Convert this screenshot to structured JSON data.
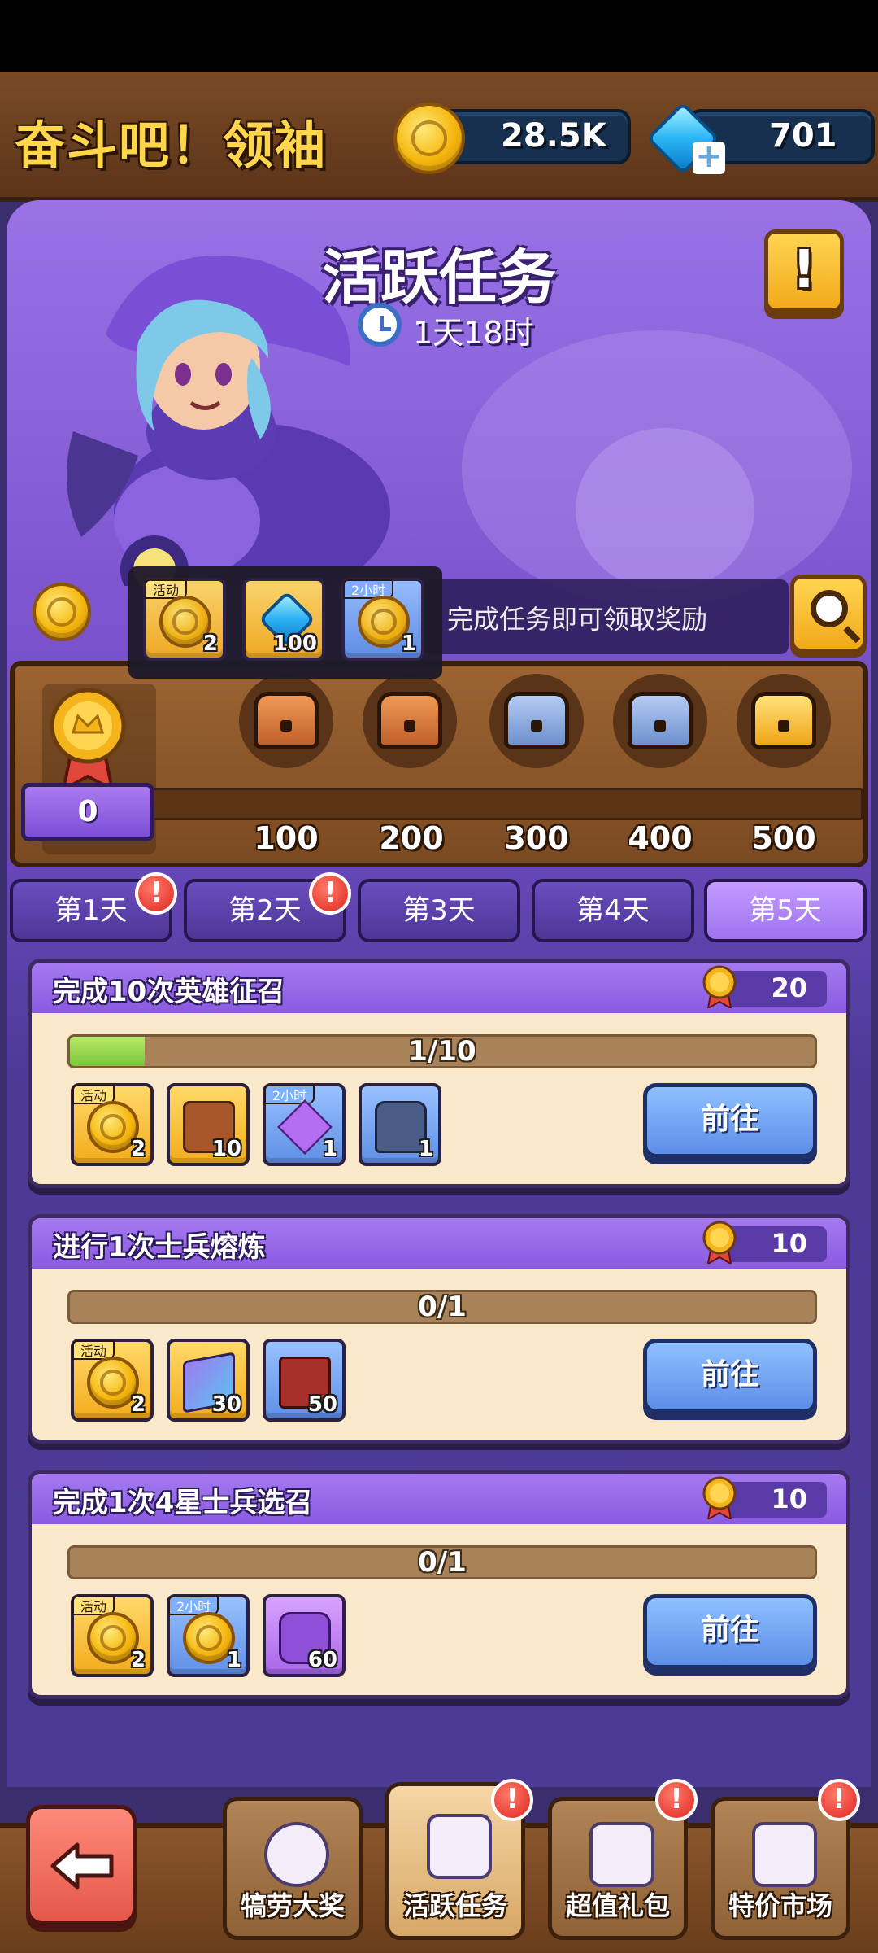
{
  "header": {
    "game_title": "奋斗吧！领袖",
    "coins": "28.5K",
    "gems": "701"
  },
  "event": {
    "title": "活跃任务",
    "time_left": "1天18时",
    "hint": "完成任务即可领取奖励"
  },
  "tooltip_rewards": [
    {
      "icon": "activity-coin-icon",
      "tag": "活动",
      "count": "2",
      "style": "gold"
    },
    {
      "icon": "gem-icon",
      "tag": "",
      "count": "100",
      "style": "gold"
    },
    {
      "icon": "coin-icon",
      "tag": "2小时",
      "count": "1",
      "style": "blue"
    }
  ],
  "milestones": {
    "current_points": "0",
    "progress": 0,
    "thresholds": [
      "100",
      "200",
      "300",
      "400",
      "500"
    ],
    "chests": [
      "bronze",
      "bronze",
      "silver",
      "silver",
      "gold"
    ]
  },
  "days": [
    {
      "label": "第1天",
      "alert": true,
      "active": false
    },
    {
      "label": "第2天",
      "alert": true,
      "active": false
    },
    {
      "label": "第3天",
      "alert": false,
      "active": false
    },
    {
      "label": "第4天",
      "alert": false,
      "active": false
    },
    {
      "label": "第5天",
      "alert": false,
      "active": true
    }
  ],
  "tasks": [
    {
      "title": "完成10次英雄征召",
      "points": "20",
      "progress_text": "1/10",
      "progress": 0.1,
      "button": "前往",
      "rewards": [
        {
          "icon": "activity-coin-icon",
          "tag": "活动",
          "count": "2",
          "style": "gold"
        },
        {
          "icon": "hero-scroll-icon",
          "tag": "",
          "count": "10",
          "style": "gold"
        },
        {
          "icon": "purple-crystal-icon",
          "tag": "2小时",
          "count": "1",
          "style": "blue"
        },
        {
          "icon": "blue-chest-icon",
          "tag": "",
          "count": "1",
          "style": "blue"
        }
      ]
    },
    {
      "title": "进行1次士兵熔炼",
      "points": "10",
      "progress_text": "0/1",
      "progress": 0,
      "button": "前往",
      "rewards": [
        {
          "icon": "activity-coin-icon",
          "tag": "活动",
          "count": "2",
          "style": "gold"
        },
        {
          "icon": "skill-book-icon",
          "tag": "",
          "count": "30",
          "style": "gold"
        },
        {
          "icon": "red-book-icon",
          "tag": "",
          "count": "50",
          "style": "blue"
        }
      ]
    },
    {
      "title": "完成1次4星士兵选召",
      "points": "10",
      "progress_text": "0/1",
      "progress": 0,
      "button": "前往",
      "rewards": [
        {
          "icon": "activity-coin-icon",
          "tag": "活动",
          "count": "2",
          "style": "gold"
        },
        {
          "icon": "coin-icon",
          "tag": "2小时",
          "count": "1",
          "style": "blue"
        },
        {
          "icon": "puzzle-piece-icon",
          "tag": "",
          "count": "60",
          "style": "purple"
        }
      ]
    }
  ],
  "bottom_nav": [
    {
      "label": "犒劳大奖",
      "icon": "prize-icon",
      "alert": false,
      "active": false
    },
    {
      "label": "活跃任务",
      "icon": "clipboard-icon",
      "alert": true,
      "active": true
    },
    {
      "label": "超值礼包",
      "icon": "gift-icon",
      "alert": true,
      "active": false
    },
    {
      "label": "特价市场",
      "icon": "shop-icon",
      "alert": true,
      "active": false
    }
  ]
}
